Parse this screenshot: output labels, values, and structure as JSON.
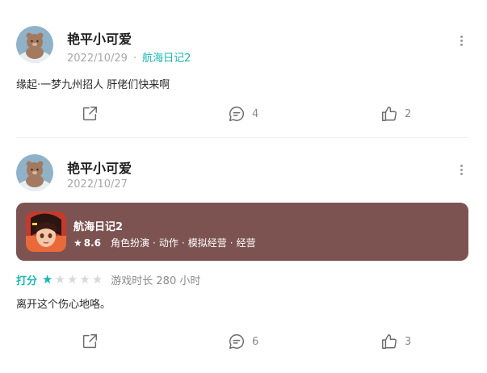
{
  "posts": [
    {
      "username": "艳平小可爱",
      "date": "2022/10/29",
      "dot": "·",
      "game_tag": "航海日记2",
      "content": "缘起·一梦九州招人 肝佬们快来啊",
      "comment_count": "4",
      "like_count": "2"
    },
    {
      "username": "艳平小可爱",
      "date": "2022/10/27",
      "content": "离开这个伤心地咯。",
      "comment_count": "6",
      "like_count": "3",
      "rating_label": "打分",
      "rating": 1,
      "rating_max": 5,
      "playtime": "游戏时长 280 小时",
      "game_card": {
        "name": "航海日记2",
        "score": "8.6",
        "tags": [
          "角色扮演",
          "动作",
          "模拟经营",
          "经营"
        ],
        "tag_separator": "·",
        "background": "#7d5352"
      }
    }
  ],
  "colors": {
    "accent": "#17b7b5",
    "muted": "#a8a8a8"
  },
  "icons": {
    "share": "share-icon",
    "comment": "comment-icon",
    "like": "thumbs-up-icon",
    "more": "more-vertical-icon",
    "star": "star-icon"
  }
}
